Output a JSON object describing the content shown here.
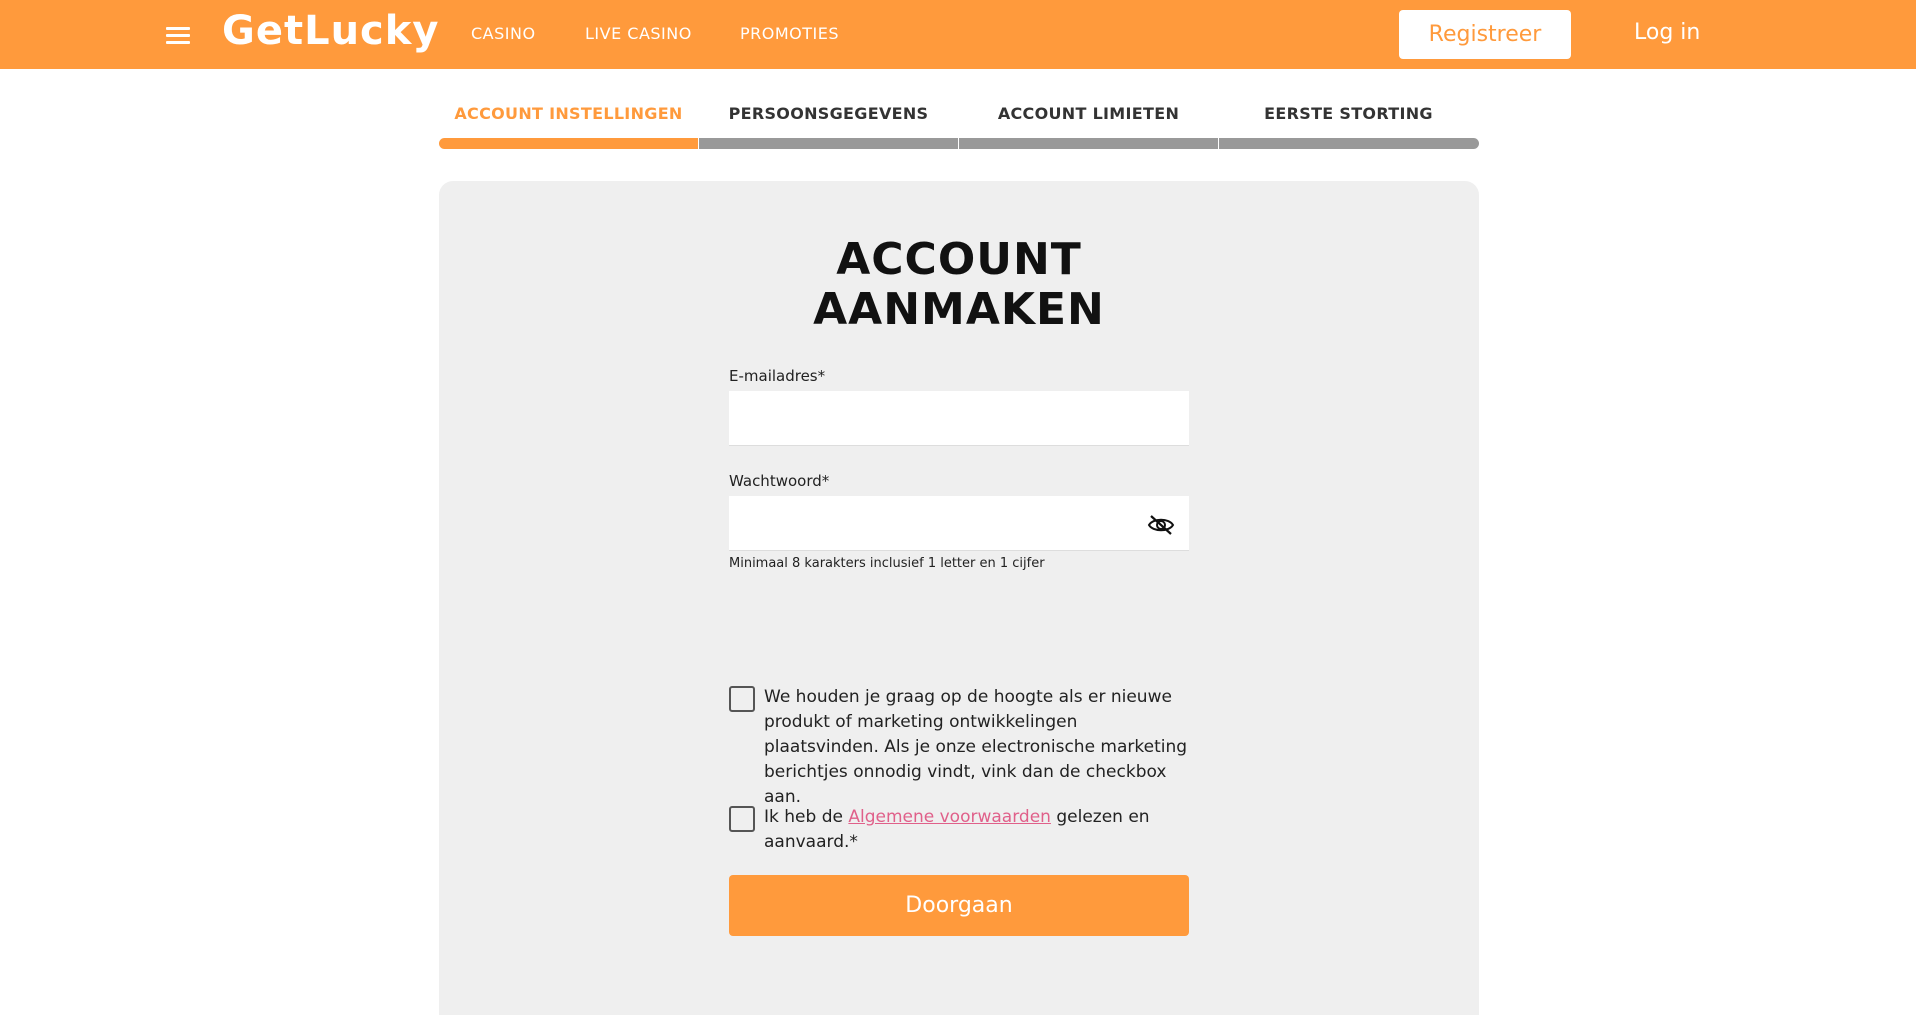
{
  "header": {
    "logo": "GetLucky",
    "nav": [
      "CASINO",
      "LIVE CASINO",
      "PROMOTIES"
    ],
    "register_label": "Registreer",
    "login_label": "Log in"
  },
  "steps": [
    {
      "label": "ACCOUNT INSTELLINGEN",
      "active": true
    },
    {
      "label": "PERSOONSGEGEVENS",
      "active": false
    },
    {
      "label": "ACCOUNT LIMIETEN",
      "active": false
    },
    {
      "label": "EERSTE STORTING",
      "active": false
    }
  ],
  "form": {
    "title_line1": "ACCOUNT",
    "title_line2": "AANMAKEN",
    "email_label": "E-mailadres*",
    "email_value": "",
    "password_label": "Wachtwoord*",
    "password_value": "",
    "password_hint": "Minimaal 8 karakters inclusief 1 letter en 1 cijfer",
    "marketing_text": "We houden je graag op de hoogte als er nieuwe produkt of marketing ontwikkelingen plaatsvinden. Als je onze electronische marketing berichtjes onnodig vindt, vink dan de checkbox aan.",
    "terms_prefix": "Ik heb de ",
    "terms_link": "Algemene voorwaarden",
    "terms_suffix": " gelezen en aanvaard.*",
    "continue_label": "Doorgaan"
  },
  "colors": {
    "brand": "#ff9a3c",
    "link": "#e0608a",
    "card_bg": "#efefef",
    "inactive_step": "#999999"
  },
  "icons": {
    "menu": "hamburger-menu-icon",
    "password_toggle": "eye-slash-icon"
  }
}
